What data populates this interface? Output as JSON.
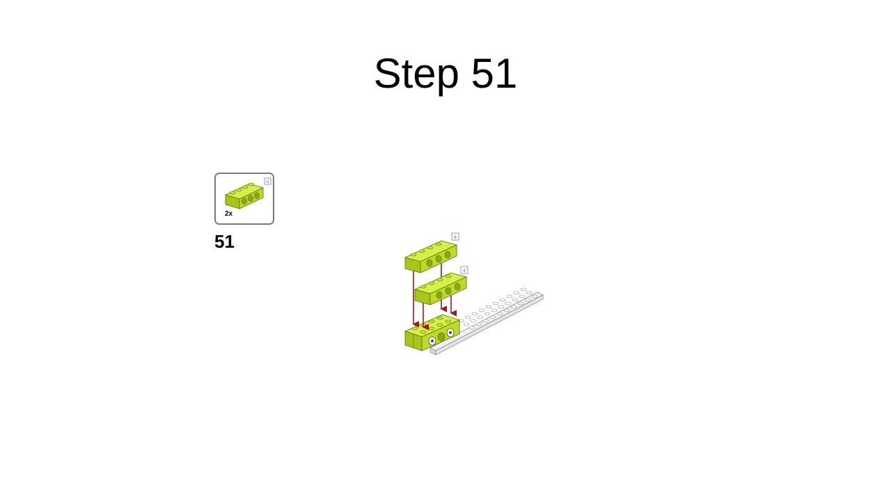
{
  "slide": {
    "title": "Step 51"
  },
  "parts_callout": {
    "quantity": "2x",
    "part_length_tag": "4",
    "part_name": "technic-brick-1x4",
    "part_color": "#b8d820"
  },
  "step": {
    "number": "51"
  },
  "assembly": {
    "part_tags": [
      "4",
      "4"
    ],
    "arrow_color": "#a01818",
    "base_plate_color": "#e8e8e8"
  }
}
